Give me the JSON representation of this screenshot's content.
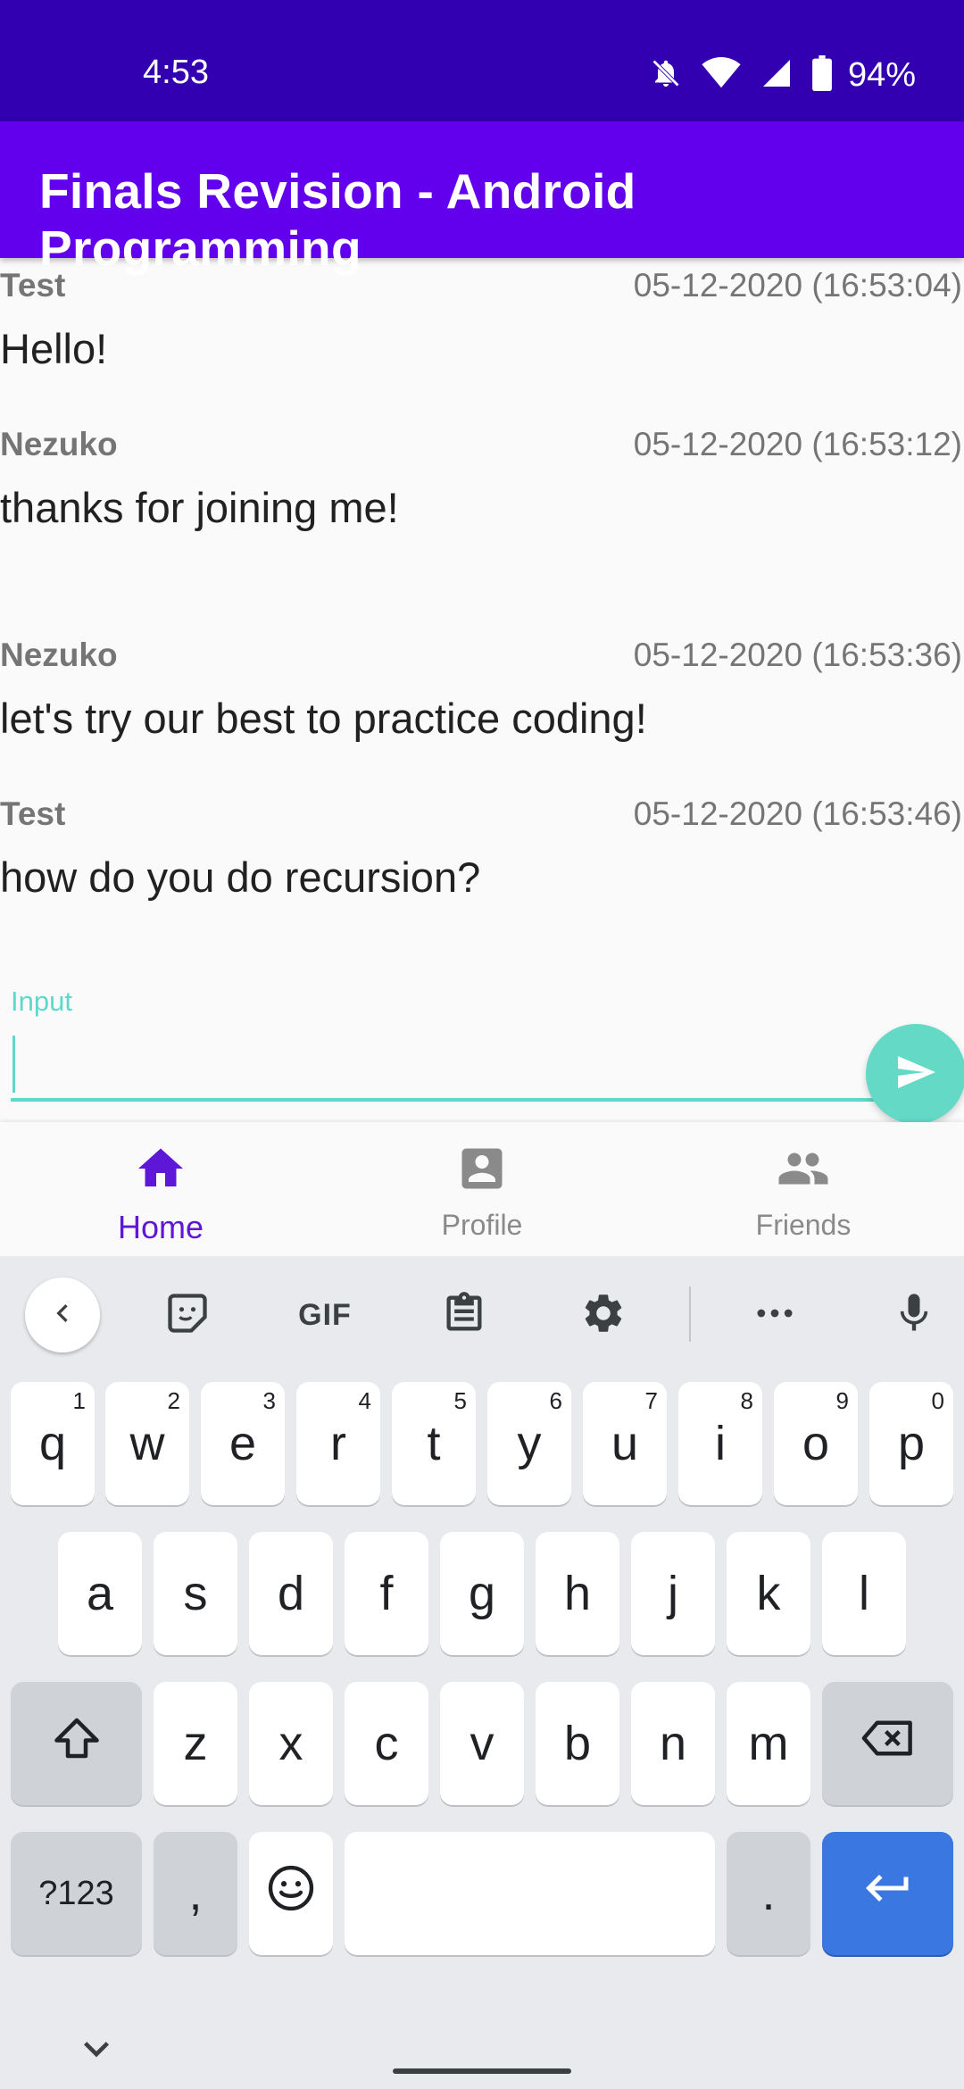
{
  "status_bar": {
    "time": "4:53",
    "battery": "94%"
  },
  "app_bar": {
    "title": "Finals Revision - Android Programming"
  },
  "messages": [
    {
      "sender": "Test",
      "timestamp": "05-12-2020 (16:53:04)",
      "text": "Hello!"
    },
    {
      "sender": "Nezuko",
      "timestamp": "05-12-2020 (16:53:12)",
      "text": "thanks for joining me!"
    },
    {
      "sender": "Nezuko",
      "timestamp": "05-12-2020 (16:53:36)",
      "text": "let's try our best to practice coding!"
    },
    {
      "sender": "Test",
      "timestamp": "05-12-2020 (16:53:46)",
      "text": "how do you do recursion?"
    }
  ],
  "input": {
    "label": "Input",
    "value": ""
  },
  "bottom_nav": {
    "items": [
      {
        "label": "Home",
        "icon": "home-icon",
        "active": true
      },
      {
        "label": "Profile",
        "icon": "profile-icon",
        "active": false
      },
      {
        "label": "Friends",
        "icon": "friends-icon",
        "active": false
      }
    ]
  },
  "keyboard": {
    "toolbar": {
      "gif_label": "GIF"
    },
    "row1": [
      {
        "key": "q",
        "hint": "1"
      },
      {
        "key": "w",
        "hint": "2"
      },
      {
        "key": "e",
        "hint": "3"
      },
      {
        "key": "r",
        "hint": "4"
      },
      {
        "key": "t",
        "hint": "5"
      },
      {
        "key": "y",
        "hint": "6"
      },
      {
        "key": "u",
        "hint": "7"
      },
      {
        "key": "i",
        "hint": "8"
      },
      {
        "key": "o",
        "hint": "9"
      },
      {
        "key": "p",
        "hint": "0"
      }
    ],
    "row2": [
      "a",
      "s",
      "d",
      "f",
      "g",
      "h",
      "j",
      "k",
      "l"
    ],
    "row3": [
      "z",
      "x",
      "c",
      "v",
      "b",
      "n",
      "m"
    ],
    "symbols_label": "?123",
    "comma": ",",
    "period": "."
  },
  "colors": {
    "status_bar": "#3200b0",
    "app_bar": "#6200ee",
    "accent_teal": "#5ed8c8",
    "nav_active": "#5e17d6",
    "enter_key": "#3a77e0"
  }
}
